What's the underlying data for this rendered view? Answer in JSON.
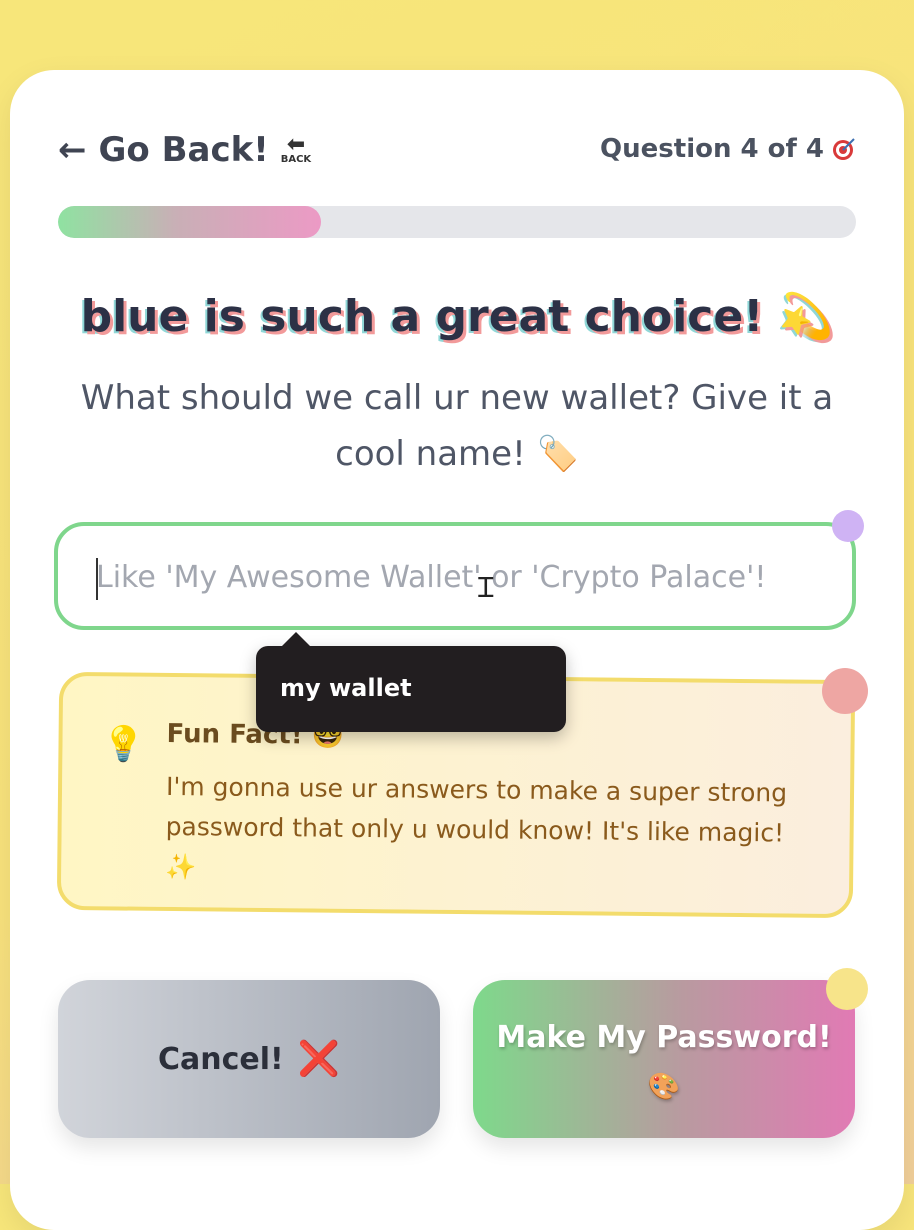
{
  "header": {
    "back_label": "Go Back!",
    "back_badge_text": "BACK",
    "question_counter": "Question 4 of 4",
    "counter_icon": "target-icon"
  },
  "progress": {
    "fraction": 0.33
  },
  "main": {
    "headline": "blue is such a great choice! 💫",
    "subtitle": "What should we call ur new wallet? Give it a cool name! 🏷️"
  },
  "wallet_name": {
    "value": "",
    "placeholder": "Like 'My Awesome Wallet' or 'Crypto Palace'!"
  },
  "autocomplete": {
    "suggestion": "my wallet"
  },
  "fun_fact": {
    "icon": "💡",
    "title": "Fun Fact! 🤓",
    "body": "I'm gonna use ur answers to make a super strong password that only u would know! It's like magic! ✨"
  },
  "actions": {
    "cancel_label": "Cancel!",
    "cancel_icon": "❌",
    "submit_label": "Make My Password!",
    "submit_icon": "🎨"
  },
  "colors": {
    "input_border": "#7fd68c",
    "funfact_border": "#f3dc6c",
    "accent_pink": "#ec9ac5",
    "accent_green": "#7ed98b"
  }
}
